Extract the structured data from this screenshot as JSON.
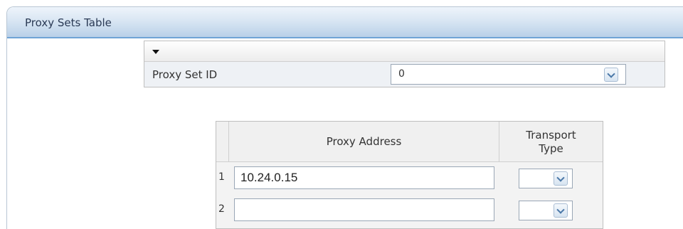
{
  "panel": {
    "title": "Proxy Sets Table"
  },
  "proxy_set": {
    "id_label": "Proxy Set ID",
    "id_value": "0"
  },
  "address_table": {
    "headers": {
      "address": "Proxy Address",
      "transport": "Transport Type"
    },
    "rows": [
      {
        "index": "1",
        "address": "10.24.0.15",
        "transport": ""
      },
      {
        "index": "2",
        "address": "",
        "transport": ""
      }
    ]
  },
  "colors": {
    "header_gradient_top": "#eef4fb",
    "header_gradient_bottom": "#b9d0e8",
    "accent": "#4a78a8"
  }
}
